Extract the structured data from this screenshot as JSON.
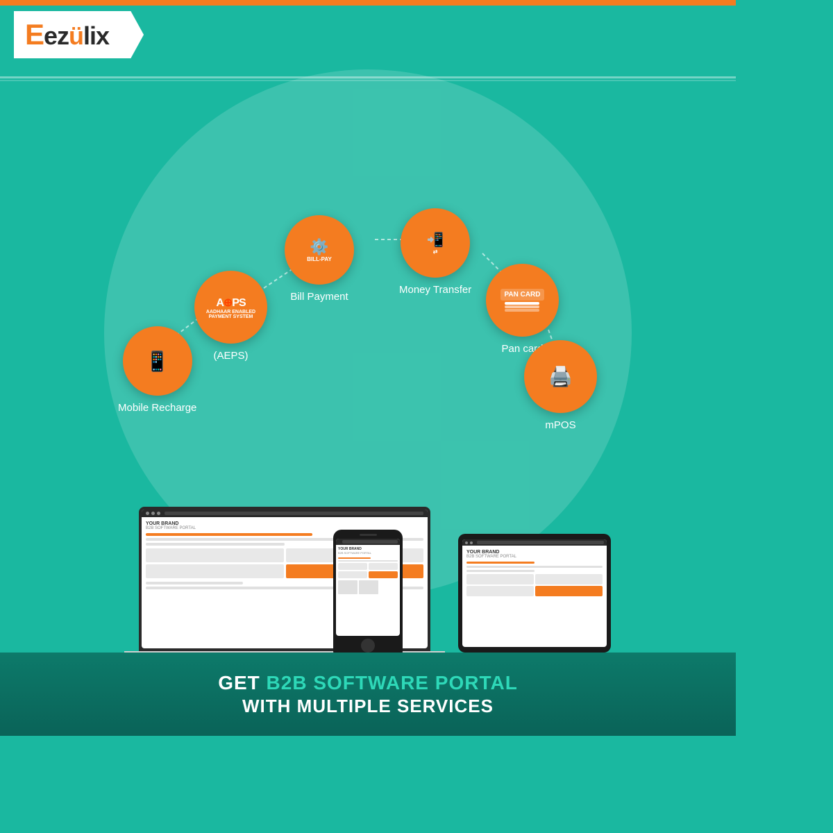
{
  "brand": {
    "name": "ezulix",
    "logo_e": "E",
    "logo_rest": "ezulix"
  },
  "tagline": {
    "line1": "GET",
    "highlight": "B2B SOFTWARE PORTAL",
    "line2": "WITH MULTIPLE SERVICES"
  },
  "services": [
    {
      "id": "aeps",
      "label": "(AEPS)",
      "icon": "AEPS",
      "sub": "Aadhaar Enabled\nPayment System"
    },
    {
      "id": "bill-payment",
      "label": "Bill\nPayment",
      "icon": "💳"
    },
    {
      "id": "money-transfer",
      "label": "Money\nTransfer",
      "icon": "📱"
    },
    {
      "id": "pan-card",
      "label": "Pan card",
      "icon": "💳"
    },
    {
      "id": "mobile-recharge",
      "label": "Mobile Recharge",
      "icon": "📱"
    },
    {
      "id": "mpos",
      "label": "mPOS",
      "icon": "🖨️"
    }
  ],
  "devices": {
    "laptop_brand": "YOUR BRAND",
    "laptop_portal": "B2B SOFTWARE PORTAL",
    "tablet_brand": "YOUR BRAND",
    "tablet_portal": "B2B SOFTWARE PORTAL",
    "phone_brand": "YOUR BRAND",
    "phone_portal": "B2B SOFTWARE PORTAL"
  }
}
